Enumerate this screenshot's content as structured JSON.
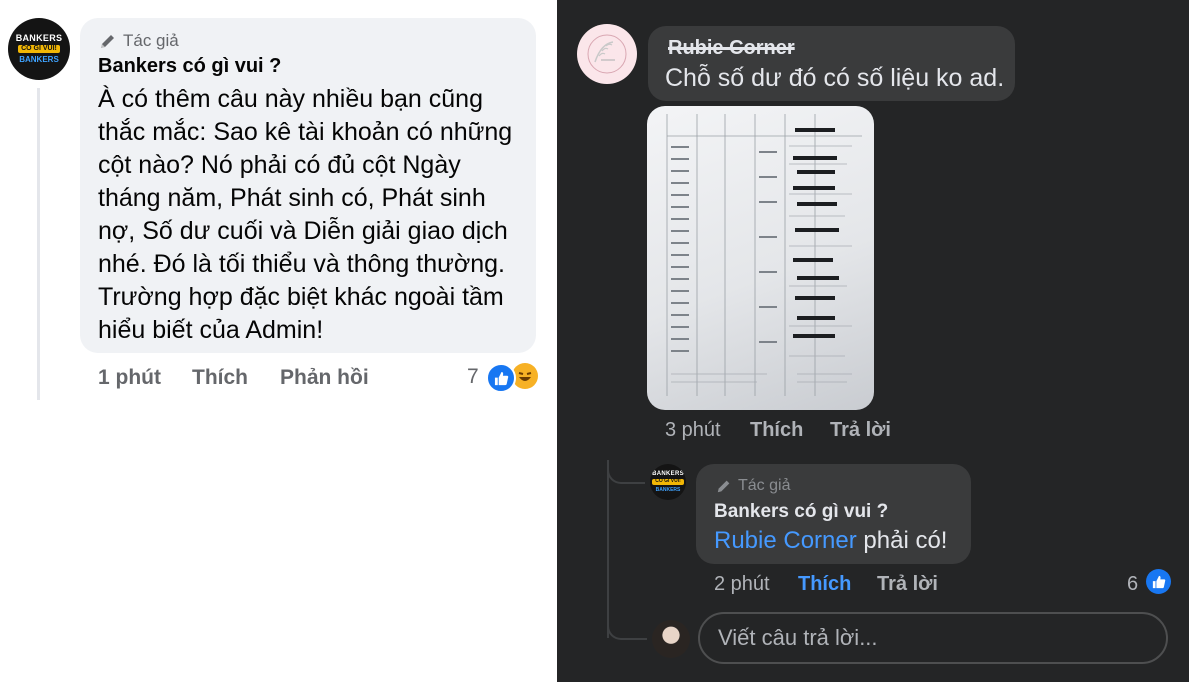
{
  "left": {
    "avatar_text": [
      "BANKERS",
      "CÓ GÌ VUI!",
      "BANKERS"
    ],
    "author_badge": "Tác giả",
    "author_name": "Bankers có gì vui ?",
    "body": "À có thêm câu này nhiều bạn cũng thắc mắc: Sao kê tài khoản có những cột nào? Nó phải có đủ cột Ngày tháng năm, Phát sinh có, Phát sinh nợ, Số dư cuối và Diễn giải giao dịch nhé. Đó là tối thiểu và thông thường. Trường hợp đặc biệt khác ngoài tầm hiểu biết của Admin!",
    "time": "1 phút",
    "like_label": "Thích",
    "reply_label": "Phản hồi",
    "reaction_count": "7"
  },
  "right": {
    "commenter_name": "Rubie Corner",
    "comment_text": "Chỗ số dư đó có số liệu ko ad.",
    "comment_time": "3 phút",
    "comment_like": "Thích",
    "comment_reply": "Trả lời",
    "reply": {
      "author_badge": "Tác giả",
      "author_name": "Bankers có gì vui ?",
      "mention": "Rubie Corner",
      "text": " phải có!",
      "time": "2 phút",
      "like_label": "Thích",
      "reply_label": "Trả lời",
      "reaction_count": "6"
    },
    "reply_placeholder": "Viết câu trả lời..."
  },
  "colors": {
    "like_blue": "#1877f2",
    "mention_blue": "#4599ff",
    "dark_bg": "#242526",
    "dark_bubble": "#3a3b3c"
  }
}
